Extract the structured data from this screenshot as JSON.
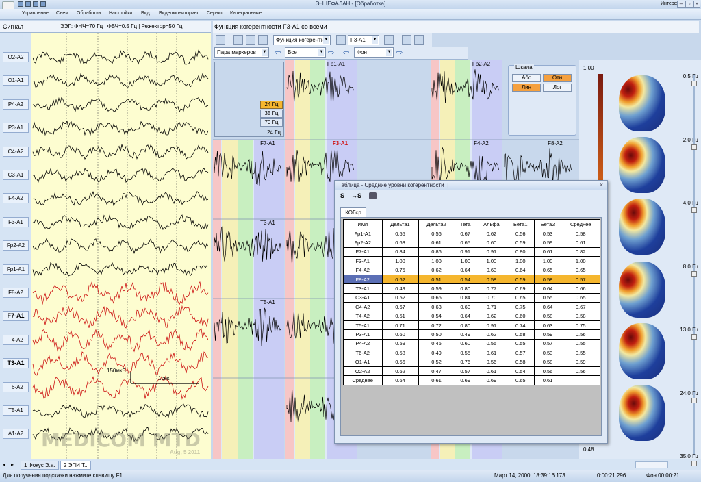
{
  "app": {
    "title": "ЭНЦЕФАЛАН - [Обработка]",
    "interface_label": "Интерфейс"
  },
  "menu": [
    "Управление",
    "Съем",
    "Обработки",
    "Настройки",
    "Вид",
    "Видеомониторинг",
    "Сервис",
    "Интегральные"
  ],
  "signal_panel": {
    "title": "Сигнал",
    "filter_info": "ЭЭГ: ФНЧ=70 Гц | ФВЧ=0.5 Гц | Режектор=50 Гц",
    "channels": [
      "O2-A2",
      "O1-A1",
      "P4-A2",
      "P3-A1",
      "C4-A2",
      "C3-A1",
      "F4-A2",
      "F3-A1",
      "Fp2-A2",
      "Fp1-A1",
      "F8-A2",
      "F7-A1",
      "T4-A2",
      "T3-A1",
      "T6-A2",
      "T5-A1",
      "A1-A2"
    ],
    "bold_channels": [
      "F7-A1",
      "T3-A1"
    ],
    "scale_amp": "150мкВ",
    "scale_time": "1сек",
    "watermark": "MEDICOM MTD",
    "watermark_date": "Aug, 5 2011"
  },
  "coherence": {
    "title": "Функция когерентности  F3-A1 со всеми",
    "func_combo": "Функция когерентн",
    "channel_combo": "F3-A1",
    "pair_combo": "Пара маркеров",
    "band_combo": "Все",
    "state_combo": "Фон",
    "freq_options": [
      "24 Гц",
      "35 Гц",
      "70 Гц"
    ],
    "freq_selected": "24 Гц",
    "freq_label": "24 Гц",
    "plots": [
      {
        "label": "Fp1-A1",
        "highlight": false
      },
      {
        "label": "Fp2-A2",
        "highlight": false
      },
      {
        "label": "F7-A1",
        "highlight": false
      },
      {
        "label": "F3-A1",
        "highlight": true
      },
      {
        "label": "F4-A2",
        "highlight": false
      },
      {
        "label": "F8-A2",
        "highlight": false
      },
      {
        "label": "T3-A1",
        "highlight": false
      },
      {
        "label": "T5-A1",
        "highlight": false
      }
    ],
    "scale": {
      "title": "Шкала",
      "abs": "Абс",
      "rel": "Отн",
      "lin": "Лин",
      "log": "Лог"
    }
  },
  "colorbar": {
    "max": "1.00",
    "min": "0.48"
  },
  "maps": {
    "frequencies": [
      "0.5 Гц",
      "2.0 Гц",
      "4.0 Гц",
      "8.0 Гц",
      "13.0 Гц",
      "24.0 Гц",
      "35.0 Гц"
    ]
  },
  "table_window": {
    "title": "Таблица - Средние уровни когерентности []",
    "tool_s": "S",
    "tool_to_s": "→S",
    "tab": "КОГср",
    "columns": [
      "Имя",
      "Дельта1",
      "Дельта2",
      "Тета",
      "Альфа",
      "Бета1",
      "Бета2",
      "Среднее"
    ],
    "rows": [
      [
        "Fp1-A1",
        "0.55",
        "0.56",
        "0.67",
        "0.62",
        "0.56",
        "0.53",
        "0.58"
      ],
      [
        "Fp2-A2",
        "0.63",
        "0.61",
        "0.65",
        "0.60",
        "0.59",
        "0.59",
        "0.61"
      ],
      [
        "F7-A1",
        "0.84",
        "0.86",
        "0.91",
        "0.91",
        "0.80",
        "0.61",
        "0.82"
      ],
      [
        "F3-A1",
        "1.00",
        "1.00",
        "1.00",
        "1.00",
        "1.00",
        "1.00",
        "1.00"
      ],
      [
        "F4-A2",
        "0.75",
        "0.62",
        "0.64",
        "0.63",
        "0.64",
        "0.65",
        "0.65"
      ],
      [
        "F8-A2",
        "0.62",
        "0.51",
        "0.54",
        "0.58",
        "0.59",
        "0.58",
        "0.57"
      ],
      [
        "T3-A1",
        "0.49",
        "0.59",
        "0.80",
        "0.77",
        "0.69",
        "0.64",
        "0.66"
      ],
      [
        "C3-A1",
        "0.52",
        "0.66",
        "0.84",
        "0.70",
        "0.65",
        "0.55",
        "0.65"
      ],
      [
        "C4-A2",
        "0.67",
        "0.63",
        "0.60",
        "0.71",
        "0.75",
        "0.64",
        "0.67"
      ],
      [
        "T4-A2",
        "0.51",
        "0.54",
        "0.64",
        "0.62",
        "0.60",
        "0.58",
        "0.58"
      ],
      [
        "T5-A1",
        "0.71",
        "0.72",
        "0.80",
        "0.91",
        "0.74",
        "0.63",
        "0.75"
      ],
      [
        "P3-A1",
        "0.60",
        "0.50",
        "0.49",
        "0.62",
        "0.58",
        "0.59",
        "0.56"
      ],
      [
        "P4-A2",
        "0.59",
        "0.46",
        "0.60",
        "0.55",
        "0.55",
        "0.57",
        "0.55"
      ],
      [
        "T6-A2",
        "0.58",
        "0.49",
        "0.55",
        "0.61",
        "0.57",
        "0.53",
        "0.55"
      ],
      [
        "O1-A1",
        "0.56",
        "0.52",
        "0.76",
        "0.56",
        "0.58",
        "0.58",
        "0.59"
      ],
      [
        "O2-A2",
        "0.62",
        "0.47",
        "0.57",
        "0.61",
        "0.54",
        "0.56",
        "0.56"
      ],
      [
        "Среднее",
        "0.64",
        "0.61",
        "0.69",
        "0.69",
        "0.65",
        "0.61",
        ""
      ]
    ],
    "selected_row": "F8-A2"
  },
  "bottom_tabs": [
    "1 Фокус Э.а.",
    "2 ЭПИ Т.."
  ],
  "status": {
    "hint": "Для получения подсказки нажмите клавишу F1",
    "datetime": "Март 14, 2000, 18:39:16.173",
    "time1": "0:00:21.296",
    "state": "Фон 00:00:21"
  },
  "colors": {
    "accent": "#f5b62e",
    "eeg_red": "#cc1111",
    "panel_bg": "#dfe9f6"
  }
}
